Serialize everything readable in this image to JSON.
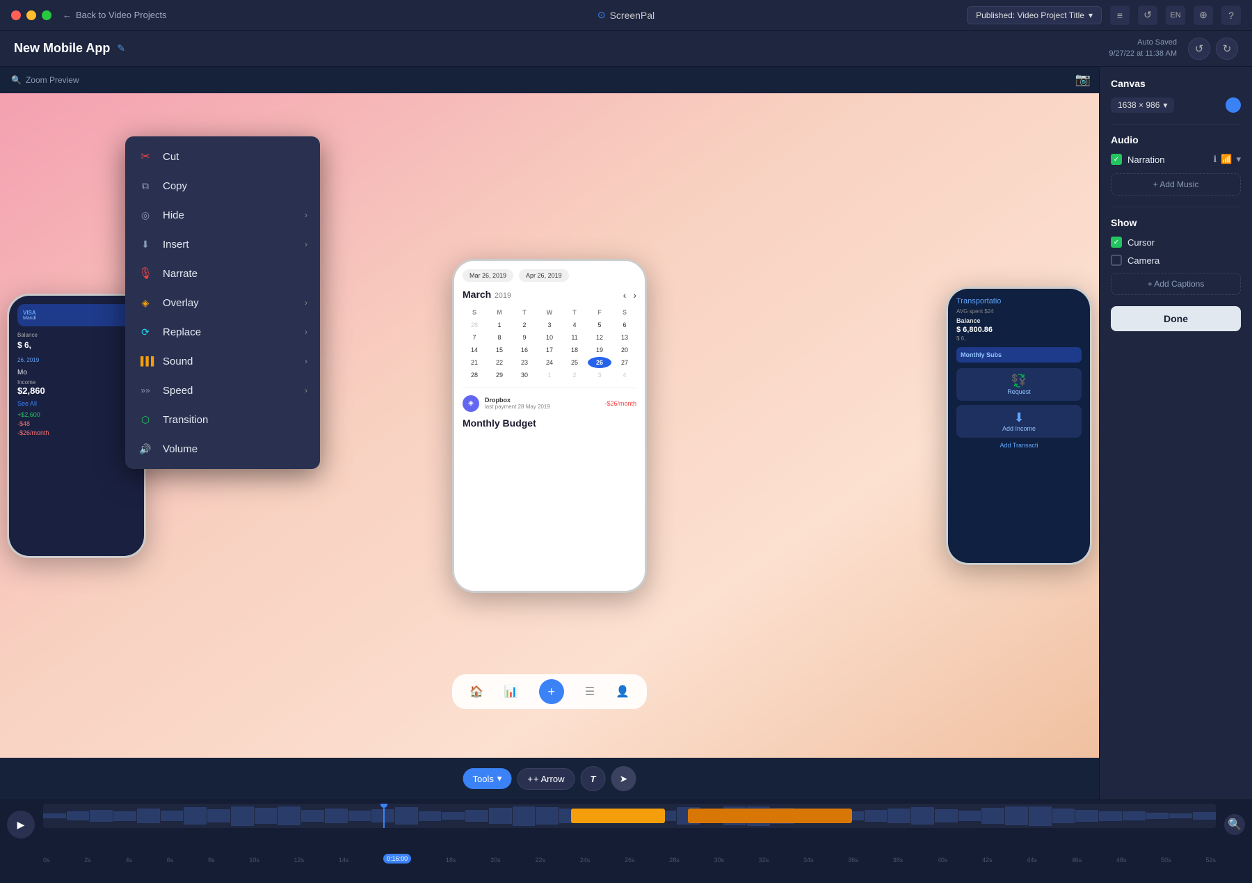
{
  "titlebar": {
    "traffic_lights": [
      "red",
      "yellow",
      "green"
    ],
    "back_label": "Back to Video Projects",
    "app_name": "ScreenPal",
    "publish_label": "Published: Video Project Title",
    "icons": [
      "filter",
      "history",
      "EN",
      "layers",
      "help"
    ]
  },
  "projectbar": {
    "title": "New Mobile App",
    "autosave_line1": "Auto Saved",
    "autosave_line2": "9/27/22 at 11:38 AM"
  },
  "context_menu": {
    "items": [
      {
        "id": "cut",
        "label": "Cut",
        "icon": "✂",
        "color": "#ef4444",
        "has_arrow": false
      },
      {
        "id": "copy",
        "label": "Copy",
        "icon": "⧉",
        "color": "#8a9bb5",
        "has_arrow": false
      },
      {
        "id": "hide",
        "label": "Hide",
        "icon": "◎",
        "color": "#8a9bb5",
        "has_arrow": true
      },
      {
        "id": "insert",
        "label": "Insert",
        "icon": "⬇",
        "color": "#8a9bb5",
        "has_arrow": true
      },
      {
        "id": "narrate",
        "label": "Narrate",
        "icon": "🎤",
        "color": "#ef4444",
        "has_arrow": false
      },
      {
        "id": "overlay",
        "label": "Overlay",
        "icon": "◈",
        "color": "#f59e0b",
        "has_arrow": true
      },
      {
        "id": "replace",
        "label": "Replace",
        "icon": "⟳",
        "color": "#22d3ee",
        "has_arrow": true
      },
      {
        "id": "sound",
        "label": "Sound",
        "icon": "▋▋▋",
        "color": "#f59e0b",
        "has_arrow": true
      },
      {
        "id": "speed",
        "label": "Speed",
        "icon": "»»",
        "color": "#8a9bb5",
        "has_arrow": true
      },
      {
        "id": "transition",
        "label": "Transition",
        "icon": "⬡",
        "color": "#22c55e",
        "has_arrow": false
      },
      {
        "id": "volume",
        "label": "Volume",
        "icon": "🔊",
        "color": "#8a9bb5",
        "has_arrow": false
      }
    ]
  },
  "canvas": {
    "zoom_label": "Zoom Preview",
    "camera_icon": "📷"
  },
  "toolbar": {
    "tools_label": "Tools",
    "arrow_label": "+ Arrow",
    "text_icon": "T",
    "cursor_icon": "➤"
  },
  "right_panel": {
    "canvas_title": "Canvas",
    "canvas_size": "1638 × 986",
    "audio_title": "Audio",
    "narration_label": "Narration",
    "add_music_label": "+ Add Music",
    "show_title": "Show",
    "cursor_label": "Cursor",
    "camera_label": "Camera",
    "add_captions_label": "+ Add Captions",
    "done_label": "Done"
  },
  "timeline": {
    "play_icon": "▶",
    "search_icon": "🔍",
    "current_time": "0:16:00",
    "ruler_marks": [
      "0s",
      "2s",
      "4s",
      "6s",
      "8s",
      "10s",
      "12s",
      "14s",
      "0:16:00",
      "18s",
      "20s",
      "22s",
      "24s",
      "26s",
      "28s",
      "30s",
      "32s",
      "34s",
      "36s",
      "38s",
      "40s",
      "42s",
      "44s",
      "46s",
      "48s",
      "50s",
      "52s"
    ]
  },
  "calendar": {
    "from_date": "Mar 26, 2019",
    "to_date": "Apr 26, 2019",
    "month": "March",
    "year": "2019",
    "day_headers": [
      "S",
      "M",
      "T",
      "W",
      "T",
      "F",
      "S"
    ],
    "days": [
      "28",
      "1",
      "2",
      "3",
      "4",
      "5",
      "6",
      "7",
      "8",
      "9",
      "10",
      "11",
      "12",
      "13",
      "14",
      "15",
      "16",
      "17",
      "18",
      "19",
      "20",
      "21",
      "22",
      "23",
      "24",
      "25",
      "26",
      "27",
      "28",
      "29",
      "30",
      "1",
      "2",
      "3",
      "4"
    ],
    "selected_day": "26"
  }
}
